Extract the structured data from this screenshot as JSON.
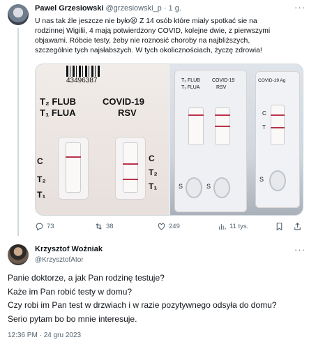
{
  "tweet1": {
    "author_name": "Pawel Grzesiowski",
    "author_handle": "@grzesiowski_p",
    "time_meta": " · 1 g.",
    "body_lines": [
      "U nas tak źle jeszcze nie było😫 Z 14 osób które miały spotkać sie na",
      "rodzinnej Wigilii, 4 mają potwierdzony COVID, kolejne dwie, z pierwszymi",
      "objawami. Róbcie testy, żeby nie roznosić choroby na najbliższych,",
      "szczególnie tych najsłabszych. W tych okolicznościach, życzę zdrowia!"
    ],
    "media": {
      "left_photo": {
        "barcode_number": "43496387",
        "label_t2_flub": "T₂ FLUB",
        "label_t1_flua": "T₁ FLUA",
        "label_covid": "COVID-19",
        "label_rsv": "RSV",
        "mark_c": "C",
        "mark_t2": "T₂",
        "mark_t1": "T₁"
      },
      "right_photo": {
        "label_flub": "T₂ FLUB",
        "label_flua": "T₁ FLUA",
        "label_covid": "COVID-19",
        "label_rsv": "RSV",
        "label_ag": "COVID-19 Ag",
        "mark_s": "S",
        "mark_c": "C",
        "mark_t": "T"
      }
    },
    "actions": {
      "replies": "73",
      "retweets": "38",
      "likes": "249",
      "views": "11 tys."
    },
    "more_glyph": "···"
  },
  "tweet2": {
    "author_name": "Krzysztof Woźniak",
    "author_handle": "@KrzysztofAtor",
    "body_lines": [
      "Panie doktorze, a jak Pan rodzinę testuje?",
      "Każe im Pan robić testy w domu?",
      "Czy robi im Pan test w drzwiach i w razie pozytywnego odsyła do domu?",
      "Serio pytam bo bo mnie interesuje."
    ],
    "timestamp": "12:36 PM · 24 gru 2023",
    "more_glyph": "···"
  },
  "colors": {
    "text_primary": "#0f1419",
    "text_secondary": "#536471",
    "border": "#cfd9de",
    "test_band": "#b8344a"
  },
  "icons": [
    "reply-icon",
    "retweet-icon",
    "like-icon",
    "views-icon",
    "bookmark-icon",
    "share-icon",
    "more-icon"
  ]
}
